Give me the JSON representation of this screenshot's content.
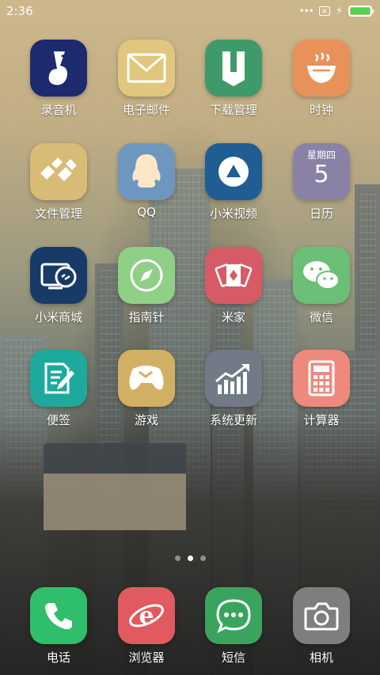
{
  "status_bar": {
    "time": "2:36",
    "battery_level": 1.0,
    "battery_color": "#4cd94b"
  },
  "home": {
    "page_indicator": {
      "pages": 3,
      "current": 2
    },
    "apps": [
      {
        "label": "录音机",
        "icon": "recorder-icon",
        "color": "#1e2a6e"
      },
      {
        "label": "电子邮件",
        "icon": "mail-icon",
        "color": "#e1c77d"
      },
      {
        "label": "下载管理",
        "icon": "download-manager-icon",
        "color": "#3f9a6b"
      },
      {
        "label": "时钟",
        "icon": "clock-icon",
        "color": "#e9915a"
      },
      {
        "label": "文件管理",
        "icon": "file-manager-icon",
        "color": "#d8bb76"
      },
      {
        "label": "QQ",
        "icon": "qq-penguin-icon",
        "color": "#6e97c0"
      },
      {
        "label": "小米视频",
        "icon": "video-play-icon",
        "color": "#1f5d92"
      },
      {
        "label": "日历",
        "icon": "calendar-icon",
        "color": "#8a82a6",
        "weekday": "星期四",
        "day": "5"
      },
      {
        "label": "小米商城",
        "icon": "mi-store-icon",
        "color": "#173a67"
      },
      {
        "label": "指南针",
        "icon": "compass-icon",
        "color": "#8fcf86"
      },
      {
        "label": "米家",
        "icon": "mijia-cards-icon",
        "color": "#d75b66"
      },
      {
        "label": "微信",
        "icon": "wechat-icon",
        "color": "#6cbf76"
      },
      {
        "label": "便签",
        "icon": "notes-icon",
        "color": "#1daa9c"
      },
      {
        "label": "游戏",
        "icon": "gamepad-icon",
        "color": "#d2b063"
      },
      {
        "label": "系统更新",
        "icon": "system-update-chart-icon",
        "color": "#717a86"
      },
      {
        "label": "计算器",
        "icon": "calculator-icon",
        "color": "#ed8a7d"
      }
    ],
    "dock": [
      {
        "label": "电话",
        "icon": "phone-icon",
        "color": "#2fbf6a"
      },
      {
        "label": "浏览器",
        "icon": "browser-icon",
        "color": "#e05a5f"
      },
      {
        "label": "短信",
        "icon": "sms-icon",
        "color": "#3aa45e"
      },
      {
        "label": "相机",
        "icon": "camera-icon",
        "color": "#7d7e80"
      }
    ]
  }
}
